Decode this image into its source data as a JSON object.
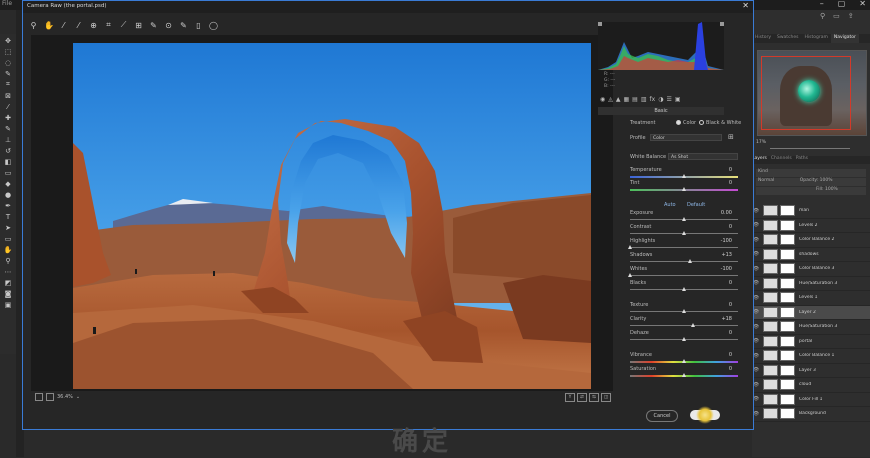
{
  "photoshop": {
    "title_fragment": "File",
    "tabs": [
      "History",
      "Swatches",
      "Histogram",
      "Navigator"
    ],
    "navigator_zoom": "17%",
    "layers_tabs": [
      "Layers",
      "Channels",
      "Paths"
    ],
    "layer_controls": {
      "kind": "Kind",
      "blend": "Normal",
      "opacity_label": "Opacity:",
      "opacity": "100%",
      "fill_label": "Fill:",
      "fill": "100%"
    },
    "layers": [
      {
        "name": "man"
      },
      {
        "name": "Levels 2"
      },
      {
        "name": "Color Balance 2"
      },
      {
        "name": "shadows"
      },
      {
        "name": "Color Balance 3"
      },
      {
        "name": "Hue/Saturation 3"
      },
      {
        "name": "Levels 1"
      },
      {
        "name": "Layer 2",
        "selected": true
      },
      {
        "name": "Hue/Saturation 3"
      },
      {
        "name": "portal"
      },
      {
        "name": "Color Balance 1"
      },
      {
        "name": "Layer 3"
      },
      {
        "name": "cloud"
      },
      {
        "name": "Color Fill 1"
      },
      {
        "name": "Background"
      }
    ]
  },
  "camera_raw": {
    "title": "Camera Raw (the portal.psd)",
    "close": "✕",
    "zoom": "36.4%",
    "histogram": {
      "readout": [
        "R: ---",
        "G: ---",
        "B: ---"
      ]
    },
    "panel_title": "Basic",
    "treatment_label": "Treatment",
    "treatment_options": [
      "Color",
      "Black & White"
    ],
    "profile_label": "Profile",
    "profile_value": "Color",
    "wb_label": "White Balance",
    "wb_value": "As Shot",
    "auto": "Auto",
    "default": "Default",
    "sliders": [
      {
        "label": "Temperature",
        "value": "0"
      },
      {
        "label": "Tint",
        "value": "0"
      },
      {
        "label": "Exposure",
        "value": "0.00"
      },
      {
        "label": "Contrast",
        "value": "0"
      },
      {
        "label": "Highlights",
        "value": "-100"
      },
      {
        "label": "Shadows",
        "value": "+13"
      },
      {
        "label": "Whites",
        "value": "-100"
      },
      {
        "label": "Blacks",
        "value": "0"
      },
      {
        "label": "Texture",
        "value": "0"
      },
      {
        "label": "Clarity",
        "value": "+18"
      },
      {
        "label": "Dehaze",
        "value": "0"
      },
      {
        "label": "Vibrance",
        "value": "0"
      },
      {
        "label": "Saturation",
        "value": "0"
      }
    ],
    "slider_levels": [
      0.5,
      0.5,
      0.5,
      0.5,
      0.0,
      0.56,
      0.0,
      0.5,
      0.5,
      0.59,
      0.5,
      0.5,
      0.5
    ],
    "cancel": "Cancel",
    "ok": "OK"
  },
  "watermark": "确定"
}
